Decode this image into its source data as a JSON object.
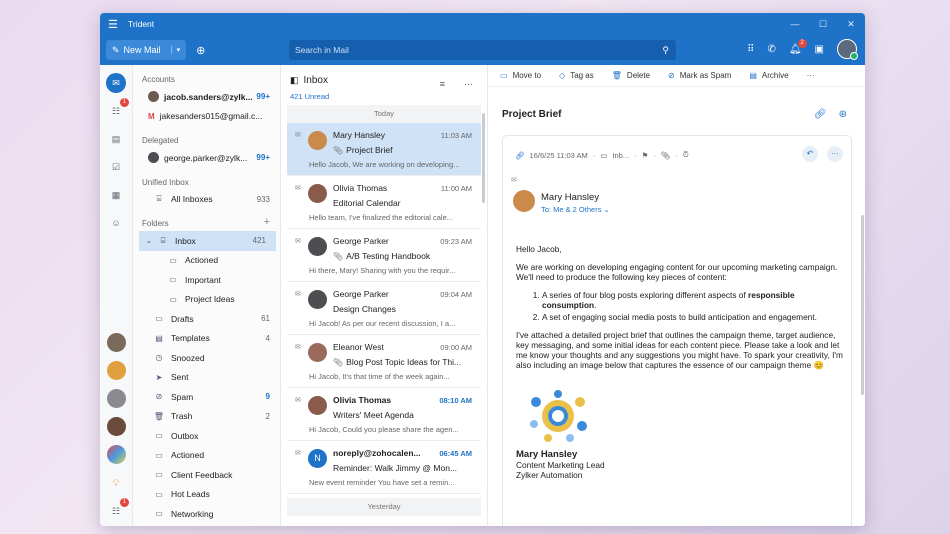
{
  "app": {
    "title": "Trident"
  },
  "toolbar": {
    "new_mail": "New Mail",
    "search_placeholder": "Search in Mail",
    "notification_count": "2"
  },
  "rail": {
    "chat_badge": "1",
    "bottom_badge": "1"
  },
  "accounts": {
    "header": "Accounts",
    "items": [
      {
        "name": "jacob.sanders@zylk...",
        "count": "99+"
      },
      {
        "name": "jakesanders015@gmail.c..."
      }
    ]
  },
  "delegated": {
    "header": "Delegated",
    "items": [
      {
        "name": "george.parker@zylk...",
        "count": "99+"
      }
    ]
  },
  "unified": {
    "header": "Unified Inbox",
    "all_inboxes": "All Inboxes",
    "count": "933"
  },
  "folders": {
    "header": "Folders",
    "add": "+",
    "items": [
      {
        "label": "Inbox",
        "count": "421",
        "level": 0,
        "selected": true
      },
      {
        "label": "Actioned",
        "level": 1
      },
      {
        "label": "Important",
        "level": 1
      },
      {
        "label": "Project Ideas",
        "level": 1
      },
      {
        "label": "Drafts",
        "count": "61",
        "level": 0
      },
      {
        "label": "Templates",
        "count": "4",
        "level": 0
      },
      {
        "label": "Snoozed",
        "level": 0
      },
      {
        "label": "Sent",
        "level": 0
      },
      {
        "label": "Spam",
        "count": "9",
        "level": 0,
        "blue": true
      },
      {
        "label": "Trash",
        "count": "2",
        "level": 0
      },
      {
        "label": "Outbox",
        "level": 0
      },
      {
        "label": "Actioned",
        "level": 0
      },
      {
        "label": "Client Feedback",
        "level": 0
      },
      {
        "label": "Hot Leads",
        "level": 0
      },
      {
        "label": "Networking",
        "level": 0
      }
    ]
  },
  "list": {
    "title": "Inbox",
    "unread": "421 Unread",
    "today": "Today",
    "yesterday": "Yesterday",
    "items": [
      {
        "from": "Mary Hansley",
        "time": "11:03 AM",
        "subject": "Project Brief",
        "preview": "Hello Jacob, We are working on developing...",
        "clip": true,
        "selected": true,
        "unread": false,
        "color": "#c98a4a"
      },
      {
        "from": "Olivia Thomas",
        "time": "11:00 AM",
        "subject": "Editorial Calendar",
        "preview": "Hello team, I've finalized the editorial cale...",
        "clip": false,
        "unread": false,
        "color": "#8a5a4a"
      },
      {
        "from": "George Parker",
        "time": "09:23 AM",
        "subject": "A/B Testing Handbook",
        "preview": "Hi there, Mary! Sharing with you the requir...",
        "clip": true,
        "unread": false,
        "color": "#4d4d52"
      },
      {
        "from": "George Parker",
        "time": "09:04 AM",
        "subject": "Design Changes",
        "preview": "Hi Jacob! As per our recent discussion, I a...",
        "clip": false,
        "unread": false,
        "color": "#4d4d52"
      },
      {
        "from": "Eleanor West",
        "time": "09:00 AM",
        "subject": "Blog Post Topic Ideas for Thi...",
        "preview": "Hi Jacob, It's that time of the week again...",
        "clip": true,
        "unread": false,
        "color": "#9a6a5c"
      },
      {
        "from": "Olivia Thomas",
        "time": "08:10 AM",
        "subject": "Writers' Meet Agenda",
        "preview": "Hi Jacob, Could you please share the agen...",
        "clip": false,
        "unread": true,
        "color": "#8a5a4a"
      },
      {
        "from": "noreply@zohocalen...",
        "time": "06:45 AM",
        "subject": "Reminder: Walk Jimmy @ Mon...",
        "preview": "New event reminder You have set a remin...",
        "clip": false,
        "unread": true,
        "color": "#1e73c8",
        "initial": "N"
      }
    ]
  },
  "reading": {
    "actions": [
      "Move to",
      "Tag as",
      "Delete",
      "Mark as Spam",
      "Archive"
    ],
    "more": "···",
    "subject": "Project Brief",
    "meta_date": "16/6/25 11:03 AM",
    "meta_folder": "Inb...",
    "sender_name": "Mary Hansley",
    "to_line": "To: Me & 2 Others",
    "greeting": "Hello Jacob,",
    "para1": "We are working on developing engaging content for our upcoming marketing campaign. We'll need to produce the following key pieces of content:",
    "li1_pre": "A series of four blog posts exploring different aspects of ",
    "li1_bold": "responsible consumption",
    "li1_post": ".",
    "li2": "A set of engaging social media posts to build anticipation and engagement.",
    "para2": "I've attached a detailed project brief that outlines the campaign theme, target audience, key messaging, and some initial ideas for each content piece. Please take a look and let me know your thoughts and any suggestions you might have. To spark your creativity, I'm also including an image below that captures the essence of our campaign theme 😊",
    "sig_name": "Mary Hansley",
    "sig_title": "Content Marketing Lead",
    "sig_company": "Zylker Automation"
  }
}
